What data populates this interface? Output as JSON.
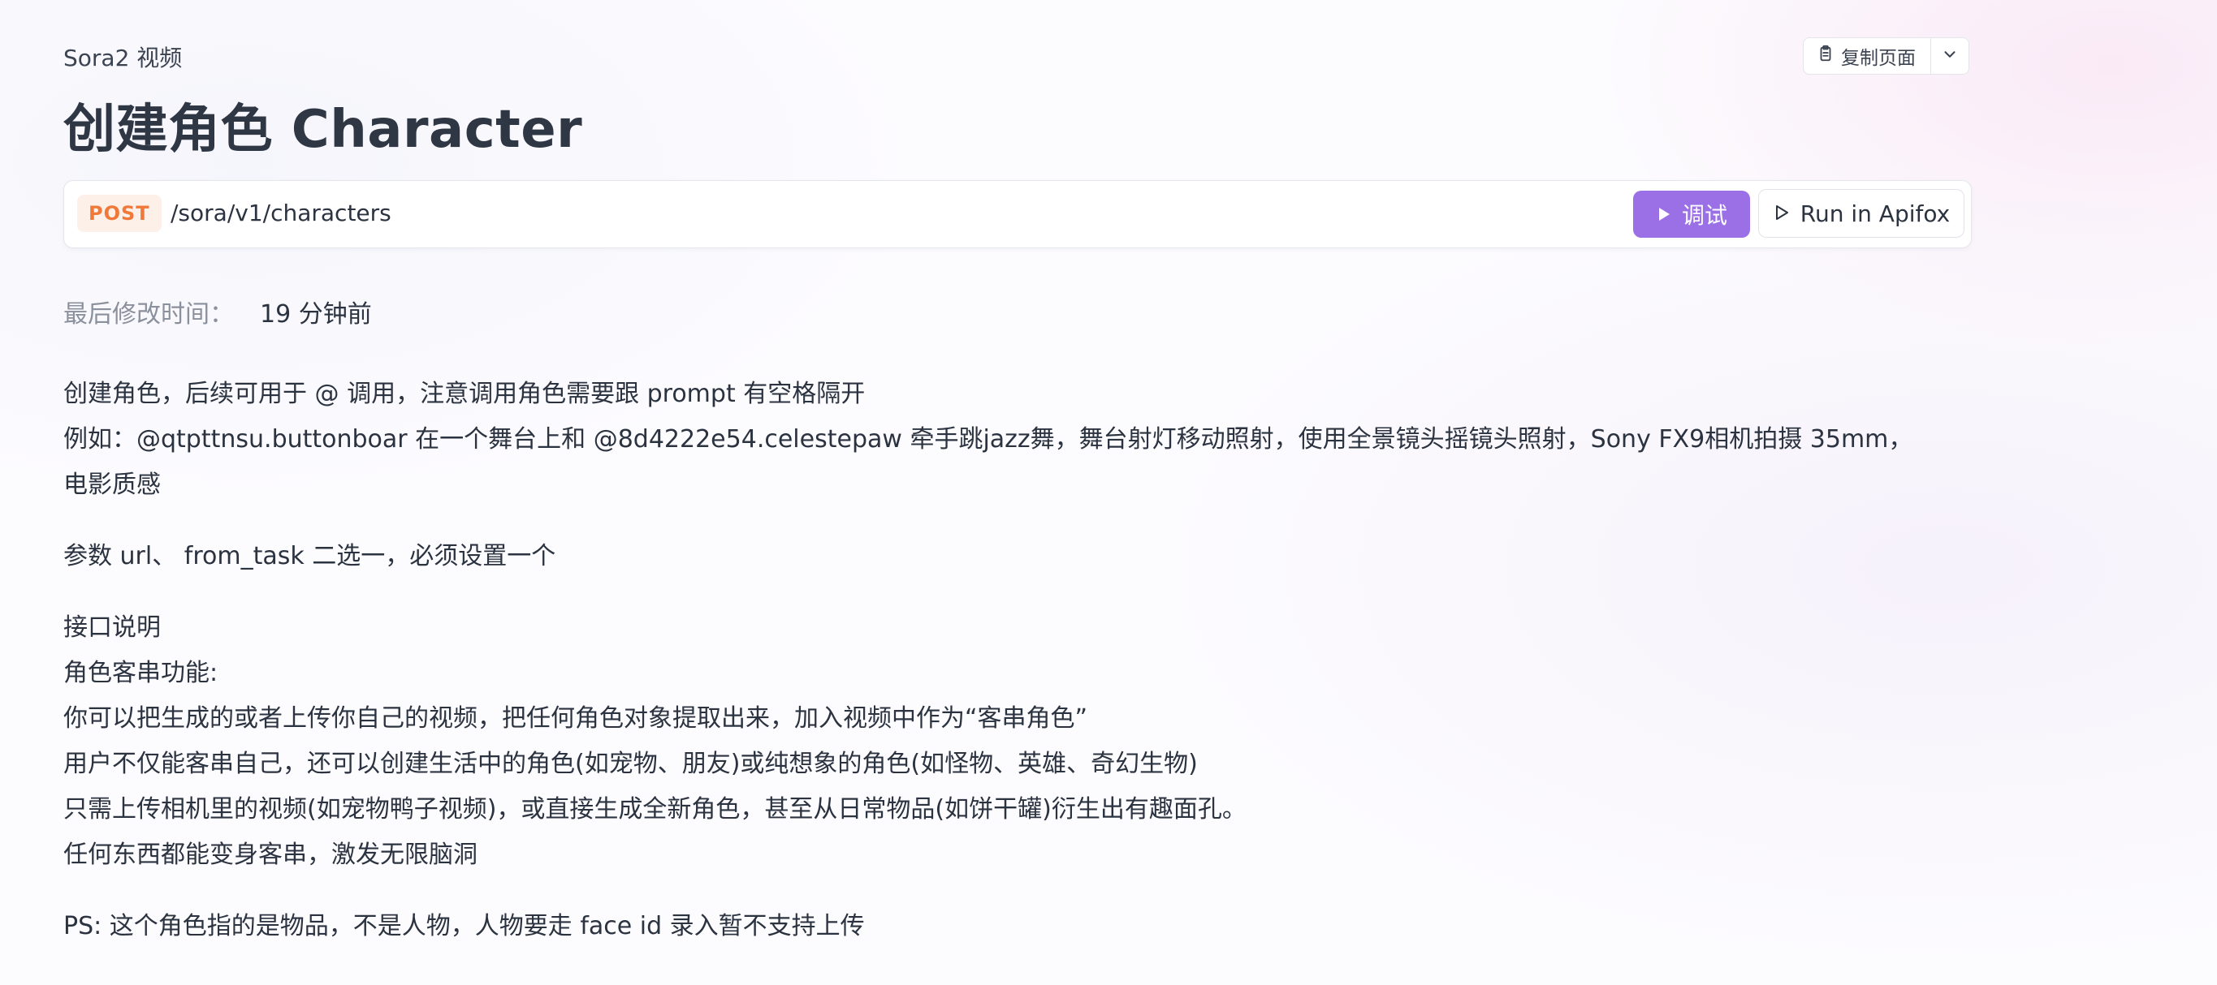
{
  "breadcrumb": "Sora2 视频",
  "toolbar": {
    "copy_label": "复制页面"
  },
  "title": "创建角色 Character",
  "endpoint": {
    "method": "POST",
    "path": "/sora/v1/characters",
    "debug_label": "调试",
    "apifox_label": "Run in Apifox"
  },
  "modified": {
    "label": "最后修改时间：",
    "value": "19 分钟前"
  },
  "description": {
    "para1_line1": "创建角色，后续可用于 @ 调用，注意调用角色需要跟 prompt 有空格隔开",
    "para1_line2": "例如：@qtpttnsu.buttonboar 在一个舞台上和 @8d4222e54.celestepaw 牵手跳jazz舞，舞台射灯移动照射，使用全景镜头摇镜头照射，Sony FX9相机拍摄 35mm，",
    "para1_line3": "电影质感",
    "para2": "参数 url、 from_task 二选一，必须设置一个",
    "para3_line1": "接口说明",
    "para3_line2": "角色客串功能:",
    "para3_line3": "你可以把生成的或者上传你自己的视频，把任何角色对象提取出来，加入视频中作为“客串角色”",
    "para3_line4": "用户不仅能客串自己，还可以创建生活中的角色(如宠物、朋友)或纯想象的角色(如怪物、英雄、奇幻生物)",
    "para3_line5": "只需上传相机里的视频(如宠物鸭子视频)，或直接生成全新角色，甚至从日常物品(如饼干罐)衍生出有趣面孔。",
    "para3_line6": "任何东西都能变身客串，激发无限脑洞",
    "para4": "PS: 这个角色指的是物品，不是人物，人物要走 face id 录入暂不支持上传"
  },
  "colors": {
    "accent": "#9b6fe6",
    "method_post": "#f0793a"
  }
}
